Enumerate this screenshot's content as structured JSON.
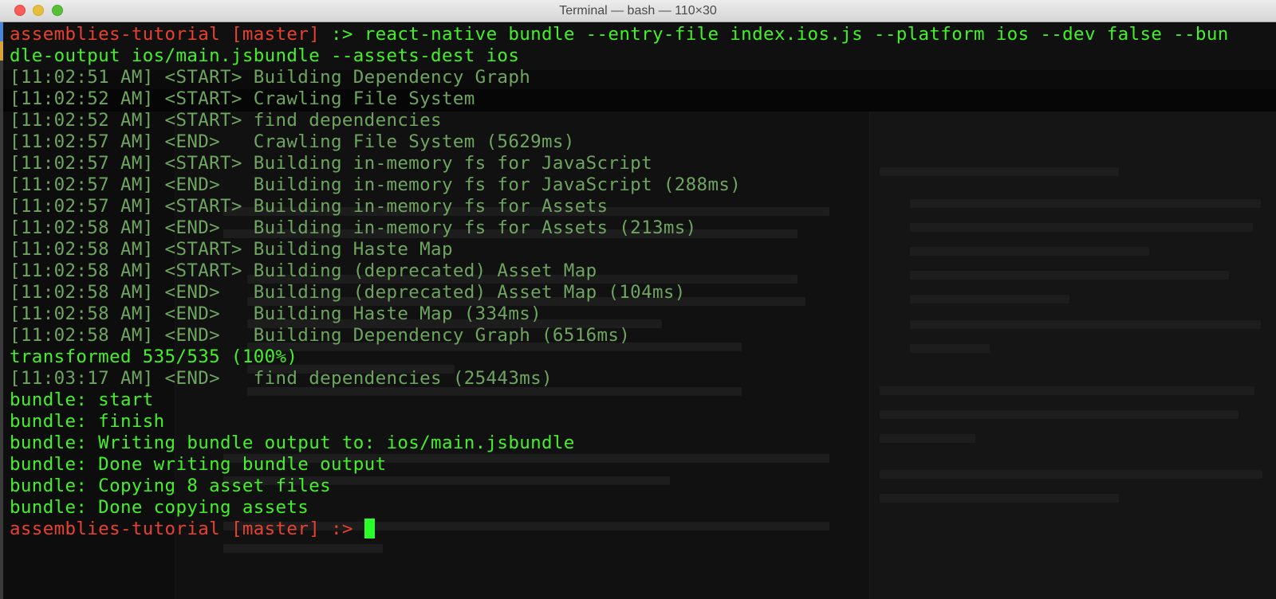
{
  "window": {
    "title": "Terminal — bash — 110×30"
  },
  "terminal": {
    "prompt": {
      "dir": "assemblies-tutorial",
      "branch": "[master]",
      "symbol": ":>"
    },
    "command_line1": " react-native bundle --entry-file index.ios.js --platform ios --dev false --bun",
    "command_line2": "dle-output ios/main.jsbundle --assets-dest ios",
    "log": [
      "[11:02:51 AM] <START> Building Dependency Graph",
      "[11:02:52 AM] <START> Crawling File System",
      "[11:02:52 AM] <START> find dependencies",
      "[11:02:57 AM] <END>   Crawling File System (5629ms)",
      "[11:02:57 AM] <START> Building in-memory fs for JavaScript",
      "[11:02:57 AM] <END>   Building in-memory fs for JavaScript (288ms)",
      "[11:02:57 AM] <START> Building in-memory fs for Assets",
      "[11:02:58 AM] <END>   Building in-memory fs for Assets (213ms)",
      "[11:02:58 AM] <START> Building Haste Map",
      "[11:02:58 AM] <START> Building (deprecated) Asset Map",
      "[11:02:58 AM] <END>   Building (deprecated) Asset Map (104ms)",
      "[11:02:58 AM] <END>   Building Haste Map (334ms)",
      "[11:02:58 AM] <END>   Building Dependency Graph (6516ms)"
    ],
    "transformed": "transformed 535/535 (100%)",
    "find_end": "[11:03:17 AM] <END>   find dependencies (25443ms)",
    "bundle": [
      "bundle: start",
      "bundle: finish",
      "bundle: Writing bundle output to: ios/main.jsbundle",
      "bundle: Done writing bundle output",
      "bundle: Copying 8 asset files",
      "bundle: Done copying assets"
    ]
  },
  "colors": {
    "prompt_dir": "#e8412f",
    "command": "#44f028",
    "log": "#6ea55f",
    "cursor": "#2bff2b"
  }
}
